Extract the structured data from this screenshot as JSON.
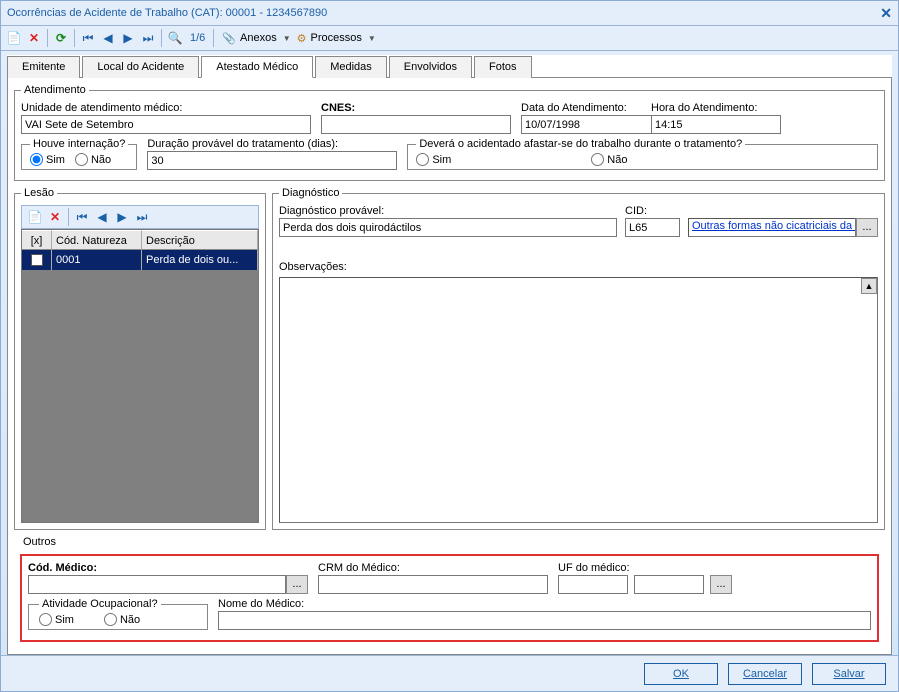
{
  "window": {
    "title": "Ocorrências de Acidente de Trabalho (CAT): 00001 - 1234567890"
  },
  "toolbar": {
    "record_pos": "1/6",
    "anexos_label": "Anexos",
    "processos_label": "Processos"
  },
  "tabs": [
    {
      "label": "Emitente"
    },
    {
      "label": "Local do Acidente"
    },
    {
      "label": "Atestado Médico"
    },
    {
      "label": "Medidas"
    },
    {
      "label": "Envolvidos"
    },
    {
      "label": "Fotos"
    }
  ],
  "atendimento": {
    "legend": "Atendimento",
    "unidade_label": "Unidade de atendimento médico:",
    "unidade_value": "VAI Sete de Setembro",
    "cnes_label": "CNES:",
    "cnes_value": "",
    "data_label": "Data do Atendimento:",
    "data_value": "10/07/1998",
    "hora_label": "Hora do Atendimento:",
    "hora_value": "14:15",
    "houve_legend": "Houve internação?",
    "sim_label": "Sim",
    "nao_label": "Não",
    "duracao_label": "Duração provável do tratamento (dias):",
    "duracao_value": "30",
    "afastar_legend": "Deverá o acidentado afastar-se do trabalho durante o tratamento?",
    "afastar_sim": "Sim",
    "afastar_nao": "Não"
  },
  "lesao": {
    "legend": "Lesão",
    "headers": {
      "x": "[x]",
      "cod": "Cód. Natureza",
      "desc": "Descrição"
    },
    "rows": [
      {
        "cod": "0001",
        "desc": "Perda de dois ou..."
      }
    ]
  },
  "diagnostico": {
    "legend": "Diagnóstico",
    "prov_label": "Diagnóstico provável:",
    "prov_value": "Perda dos dois quirodáctilos",
    "cid_label": "CID:",
    "cid_value": "L65",
    "cid_link": "Outras formas não cicatriciais da p",
    "obs_label": "Observações:",
    "obs_value": ""
  },
  "outros": {
    "legend": "Outros",
    "cod_label": "Cód. Médico:",
    "cod_value": "",
    "crm_label": "CRM do Médico:",
    "crm_value": "",
    "uf_label": "UF do médico:",
    "uf_value": "",
    "atividade_legend": "Atividade Ocupacional?",
    "atividade_sim": "Sim",
    "atividade_nao": "Não",
    "nome_label": "Nome do Médico:",
    "nome_value": ""
  },
  "footer": {
    "ok": "OK",
    "cancel": "Cancelar",
    "save": "Salvar"
  }
}
